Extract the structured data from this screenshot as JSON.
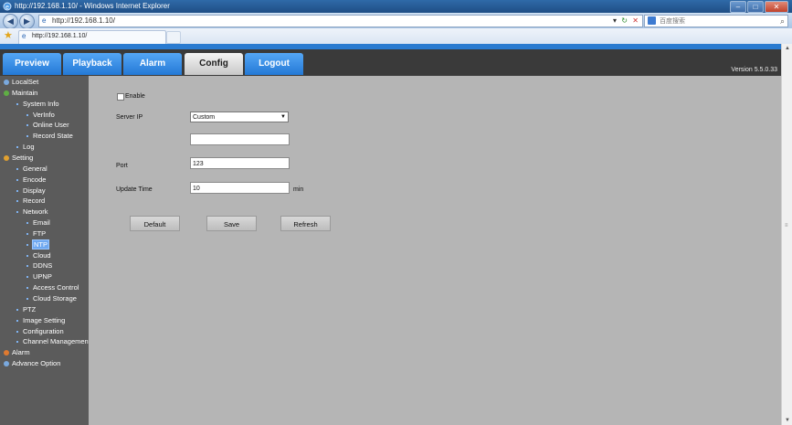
{
  "window": {
    "title": "http://192.168.1.10/ - Windows Internet Explorer",
    "buttons": [
      "–",
      "□",
      "✕"
    ]
  },
  "address_bar": {
    "url": "http://192.168.1.10/",
    "refresh": "↻",
    "stop": "✕",
    "search_placeholder": "百度搜索",
    "search_icon": "magnifier-icon"
  },
  "favorites": {
    "tab_url": "http://192.168.1.10/"
  },
  "nav": {
    "tabs": [
      "Preview",
      "Playback",
      "Alarm",
      "Config",
      "Logout"
    ],
    "active": "Config",
    "version": "Version 5.5.0.33"
  },
  "sidebar": {
    "items": [
      {
        "label": "LocalSet",
        "level": 0,
        "icon": "localset-icon",
        "color": "#7aa9de"
      },
      {
        "label": "Maintain",
        "level": 0,
        "icon": "maintain-icon",
        "color": "#5fae44"
      },
      {
        "label": "System Info",
        "level": 1
      },
      {
        "label": "VerInfo",
        "level": 2
      },
      {
        "label": "Online User",
        "level": 2
      },
      {
        "label": "Record State",
        "level": 2
      },
      {
        "label": "Log",
        "level": 1
      },
      {
        "label": "Setting",
        "level": 0,
        "icon": "setting-icon",
        "color": "#e0a030"
      },
      {
        "label": "General",
        "level": 1
      },
      {
        "label": "Encode",
        "level": 1
      },
      {
        "label": "Display",
        "level": 1
      },
      {
        "label": "Record",
        "level": 1
      },
      {
        "label": "Network",
        "level": 1
      },
      {
        "label": "Email",
        "level": 2
      },
      {
        "label": "FTP",
        "level": 2
      },
      {
        "label": "NTP",
        "level": 2,
        "selected": true
      },
      {
        "label": "Cloud",
        "level": 2
      },
      {
        "label": "DDNS",
        "level": 2
      },
      {
        "label": "UPNP",
        "level": 2
      },
      {
        "label": "Access Control",
        "level": 2
      },
      {
        "label": "Cloud Storage",
        "level": 2
      },
      {
        "label": "PTZ",
        "level": 1
      },
      {
        "label": "Image Setting",
        "level": 1
      },
      {
        "label": "Configuration",
        "level": 1
      },
      {
        "label": "Channel Management",
        "level": 1
      },
      {
        "label": "Alarm",
        "level": 0,
        "icon": "alarm-icon",
        "color": "#e07a30"
      },
      {
        "label": "Advance Option",
        "level": 0,
        "icon": "advance-icon",
        "color": "#7aa9de"
      }
    ]
  },
  "form": {
    "enable_label": "Enable",
    "enable_checked": false,
    "server_ip_label": "Server IP",
    "server_ip_selected": "Custom",
    "server_custom_value": "",
    "port_label": "Port",
    "port_value": "123",
    "update_time_label": "Update Time",
    "update_time_value": "10",
    "update_time_unit": "min",
    "buttons": {
      "default": "Default",
      "save": "Save",
      "refresh": "Refresh"
    }
  },
  "colors": {
    "accent_blue": "#2a7bd0",
    "tab_blue": "#3a8ee6",
    "sidebar_bg": "#5b5b5b",
    "content_bg": "#b5b5b5",
    "selected": "#6ea8f0"
  }
}
